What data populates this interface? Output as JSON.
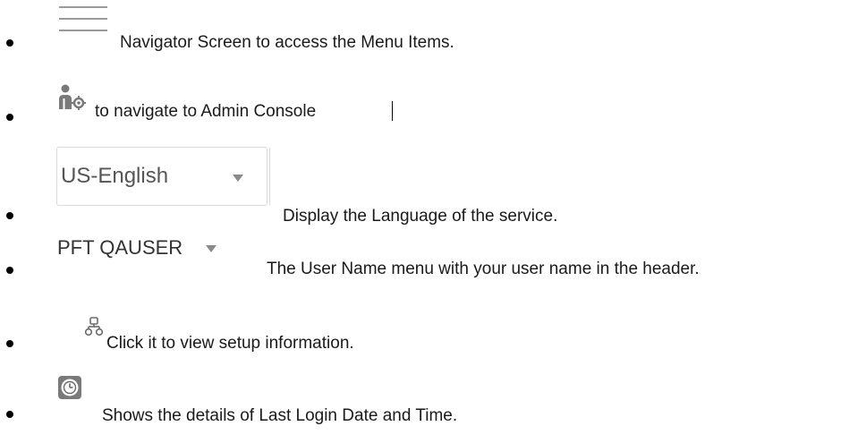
{
  "items": [
    {
      "icon": "hamburger-menu-icon",
      "text": "Navigator Screen to access the Menu Items."
    },
    {
      "icon": "admin-console-icon",
      "text": "to navigate to Admin Console"
    },
    {
      "icon": "language-select",
      "control_value": "US-English",
      "text": "Display the Language of the service."
    },
    {
      "icon": "user-name-menu",
      "control_value": "PFT QAUSER",
      "text": "The User Name menu with your user name in the header."
    },
    {
      "icon": "setup-hierarchy-icon",
      "text": "Click it to view setup information."
    },
    {
      "icon": "last-login-clock-icon",
      "text": "Shows the details of Last Login Date and Time."
    }
  ],
  "colors": {
    "icon_gray": "#7a7a7a",
    "border": "#d9d9d9",
    "text": "#1a1a1a"
  }
}
